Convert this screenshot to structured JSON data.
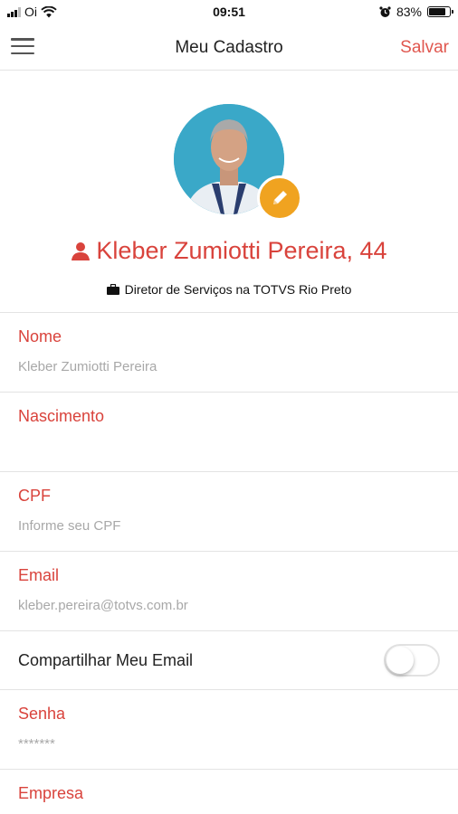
{
  "status_bar": {
    "carrier": "Oi",
    "time": "09:51",
    "battery": "83%",
    "battery_level": 0.83,
    "icons": [
      "signal-icon",
      "wifi-icon",
      "alarm-icon",
      "battery-icon"
    ]
  },
  "nav": {
    "title": "Meu Cadastro",
    "save_label": "Salvar",
    "menu_icon": "hamburger-menu-icon"
  },
  "profile": {
    "name": "Kleber Zumiotti Pereira, 44",
    "job": "Diretor de Serviços na TOTVS Rio Preto",
    "name_icon": "user-icon",
    "job_icon": "briefcase-icon",
    "edit_icon": "pencil-icon"
  },
  "fields": {
    "nome": {
      "label": "Nome",
      "value": "Kleber Zumiotti Pereira"
    },
    "nascimento": {
      "label": "Nascimento",
      "value": ""
    },
    "cpf": {
      "label": "CPF",
      "placeholder": "Informe seu CPF"
    },
    "email": {
      "label": "Email",
      "value": "kleber.pereira@totvs.com.br"
    },
    "share_email": {
      "label": "Compartilhar Meu Email",
      "enabled": false
    },
    "senha": {
      "label": "Senha",
      "value": "*******"
    },
    "empresa": {
      "label": "Empresa"
    }
  },
  "colors": {
    "accent": "#d9433c",
    "save": "#e0574f",
    "edit_badge": "#f0a320",
    "avatar_bg": "#3aa8c8",
    "placeholder": "#a8a8a8",
    "divider": "#e3e3e3"
  }
}
